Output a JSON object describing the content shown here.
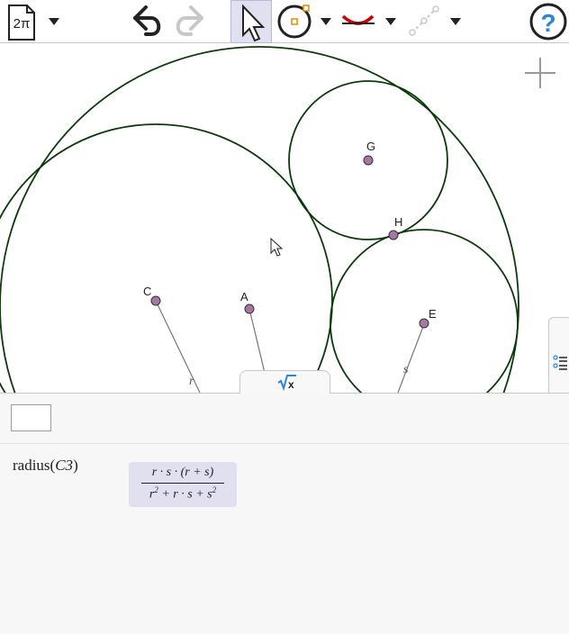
{
  "toolbar": {
    "menu_label": "2π",
    "tools": [
      "undo",
      "redo",
      "move",
      "circle",
      "arc",
      "line"
    ]
  },
  "points": [
    {
      "name": "G"
    },
    {
      "name": "H"
    },
    {
      "name": "C"
    },
    {
      "name": "A"
    },
    {
      "name": "E"
    }
  ],
  "segments": [
    {
      "name": "r"
    },
    {
      "name": "s"
    }
  ],
  "panel": {
    "input_placeholder": "",
    "command_fn": "radius",
    "command_arg": "C3",
    "result_numerator": "r · s · (r + s)",
    "result_den_r2": "r",
    "result_den_mid": " + r · s + s",
    "result_exp": "2"
  },
  "colors": {
    "circle": "#0b3a0b",
    "point_fill": "#a577a5",
    "accent_blue": "#2a86d8",
    "arc_red": "#cc0000",
    "result_bg": "#e0e0f0"
  }
}
